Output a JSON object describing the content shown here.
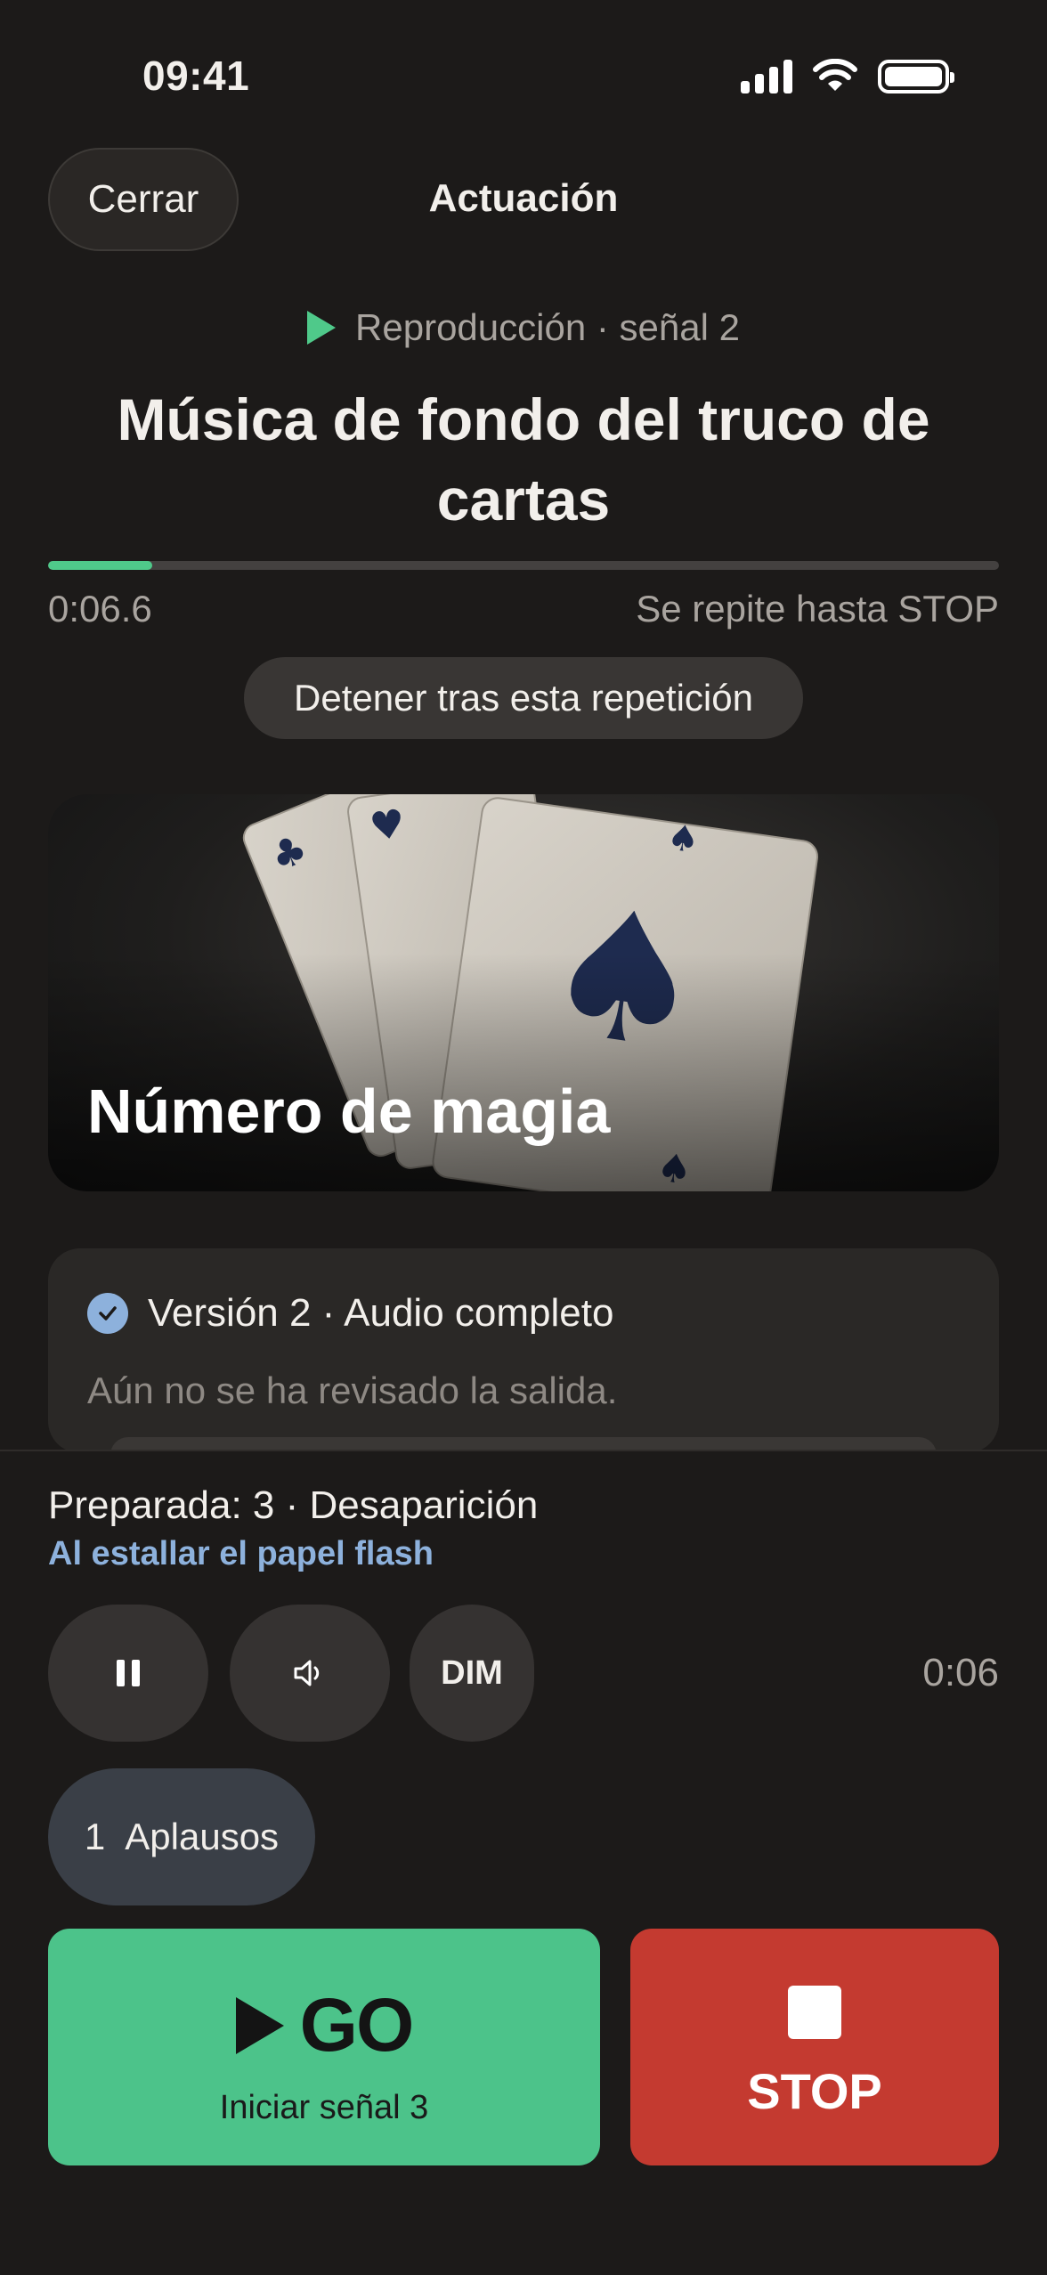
{
  "status_bar": {
    "time": "09:41"
  },
  "header": {
    "close_label": "Cerrar",
    "title": "Actuación"
  },
  "cue": {
    "label": "Reproducción · señal 2",
    "title": "Música de fondo del truco de cartas",
    "progress_fraction": 0.11,
    "elapsed": "0:06.6",
    "repeat_note": "Se repite hasta STOP",
    "stop_after_label": "Detener tras esta repetición"
  },
  "image_card": {
    "title": "Número de magia"
  },
  "version": {
    "label": "Versión 2 · Audio completo",
    "note": "Aún no se ha revisado la salida."
  },
  "bottom": {
    "ready": "Preparada: 3 · Desaparición",
    "trigger": "Al estallar el papel flash",
    "dim_label": "DIM",
    "elapsed_short": "0:06",
    "applause_number": "1",
    "applause_label": "Aplausos",
    "go_label": "GO",
    "go_sub": "Iniciar señal 3",
    "stop_label": "STOP"
  },
  "colors": {
    "background": "#1c1a19",
    "accent_green": "#4cc38a",
    "stop_red": "#c43a30",
    "link_blue": "#8db1dc"
  },
  "icons": [
    "signal-icon",
    "wifi-icon",
    "battery-icon",
    "play-icon",
    "check-icon",
    "pause-icon",
    "volume-icon",
    "stop-icon"
  ]
}
